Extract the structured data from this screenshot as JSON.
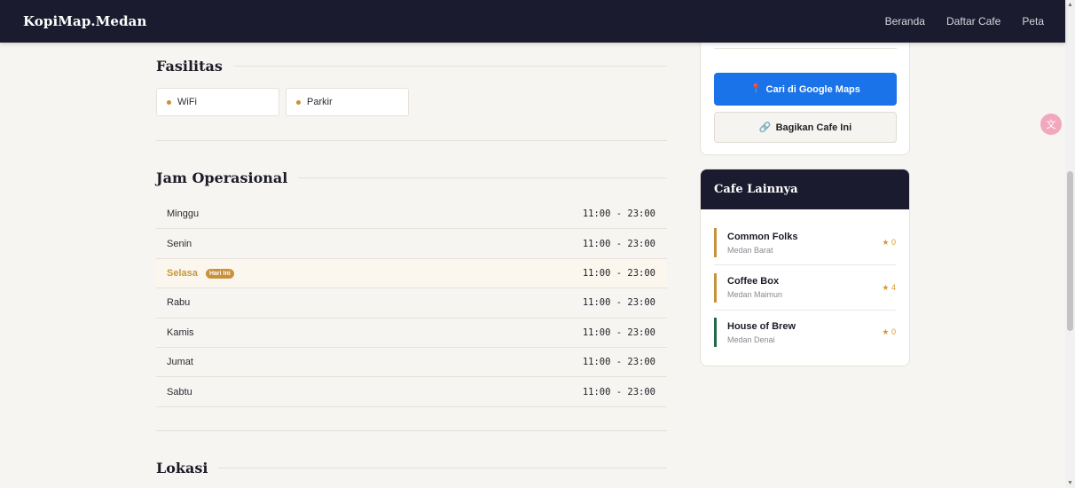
{
  "nav": {
    "brand": "KopiMap.Medan",
    "links": [
      "Beranda",
      "Daftar Cafe",
      "Peta"
    ]
  },
  "facilities": {
    "title": "Fasilitas",
    "items": [
      "WiFi",
      "Parkir"
    ]
  },
  "hours": {
    "title": "Jam Operasional",
    "today_badge": "Hari Ini",
    "rows": [
      {
        "day": "Minggu",
        "time": "11:00 - 23:00"
      },
      {
        "day": "Senin",
        "time": "11:00 - 23:00"
      },
      {
        "day": "Selasa",
        "time": "11:00 - 23:00"
      },
      {
        "day": "Rabu",
        "time": "11:00 - 23:00"
      },
      {
        "day": "Kamis",
        "time": "11:00 - 23:00"
      },
      {
        "day": "Jumat",
        "time": "11:00 - 23:00"
      },
      {
        "day": "Sabtu",
        "time": "11:00 - 23:00"
      }
    ]
  },
  "location": {
    "title": "Lokasi"
  },
  "actions": {
    "maps_label": "Cari di Google Maps",
    "share_label": "Bagikan Cafe Ini"
  },
  "other_cafes": {
    "title": "Cafe Lainnya",
    "items": [
      {
        "name": "Common Folks",
        "area": "Medan Barat",
        "rating": "★ 0",
        "accent": "#c8913c"
      },
      {
        "name": "Coffee Box",
        "area": "Medan Maimun",
        "rating": "★ 4",
        "accent": "#c8913c"
      },
      {
        "name": "House of Brew",
        "area": "Medan Denai",
        "rating": "★ 0",
        "accent": "#1f6b45"
      }
    ]
  },
  "colors": {
    "navbar": "#1b1b2f",
    "accent": "#c8913c",
    "maps_button": "#1a73e8"
  },
  "icons": [
    "pin-icon",
    "link-icon",
    "translate-icon",
    "star-icon"
  ]
}
